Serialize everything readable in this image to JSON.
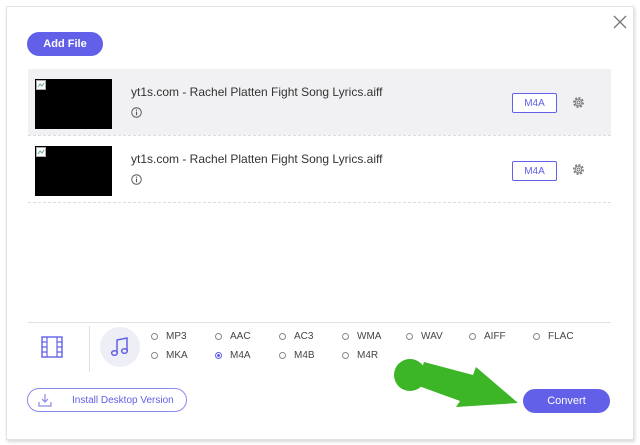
{
  "toolbar": {
    "add_file_label": "Add File"
  },
  "files": [
    {
      "name": "yt1s.com - Rachel Platten Fight Song Lyrics.aiff",
      "format": "M4A",
      "selected": true
    },
    {
      "name": "yt1s.com - Rachel Platten Fight Song Lyrics.aiff",
      "format": "M4A",
      "selected": false
    }
  ],
  "format_panel": {
    "tabs": [
      "video-tab",
      "audio-tab"
    ],
    "active_tab": "audio-tab",
    "options": [
      "MP3",
      "AAC",
      "AC3",
      "WMA",
      "WAV",
      "AIFF",
      "FLAC",
      "MKA",
      "M4A",
      "M4B",
      "M4R"
    ],
    "selected": "M4A"
  },
  "footer": {
    "install_label": "Install Desktop Version",
    "convert_label": "Convert"
  },
  "colors": {
    "accent": "#6260e8",
    "annotation_arrow": "#3cb526"
  }
}
